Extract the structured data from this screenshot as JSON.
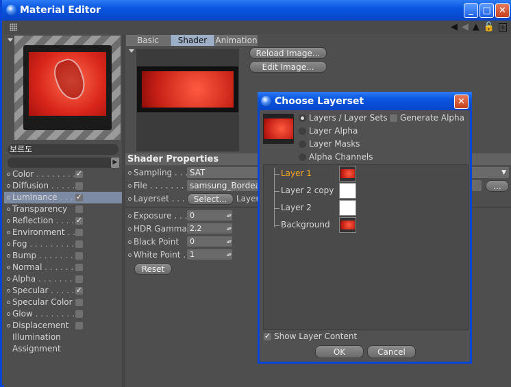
{
  "window": {
    "title": "Material Editor"
  },
  "material": {
    "name": "보르도"
  },
  "channels": [
    {
      "label": "Color",
      "dots": " . . . . . . . .",
      "checked": true
    },
    {
      "label": "Diffusion",
      "dots": " . . . . . .",
      "checked": false
    },
    {
      "label": "Luminance",
      "dots": " . . .",
      "checked": true,
      "selected": true
    },
    {
      "label": "Transparency",
      "dots": "",
      "checked": false
    },
    {
      "label": "Reflection",
      "dots": " . . . .",
      "checked": true
    },
    {
      "label": "Environment",
      "dots": " . .",
      "checked": false
    },
    {
      "label": "Fog",
      "dots": " . . . . . . . . . .",
      "checked": false
    },
    {
      "label": "Bump",
      "dots": " . . . . . . . .",
      "checked": false
    },
    {
      "label": "Normal",
      "dots": " . . . . . . .",
      "checked": false
    },
    {
      "label": "Alpha",
      "dots": " . . . . . . . .",
      "checked": false
    },
    {
      "label": "Specular",
      "dots": " . . . . .",
      "checked": true
    },
    {
      "label": "Specular Color",
      "dots": "",
      "checked": false
    },
    {
      "label": "Glow",
      "dots": " . . . . . . . . .",
      "checked": false
    },
    {
      "label": "Displacement",
      "dots": "",
      "checked": false
    }
  ],
  "extra_items": [
    "Illumination",
    "Assignment"
  ],
  "tabs": [
    "Basic",
    "Shader",
    "Animation"
  ],
  "active_tab": "Shader",
  "buttons": {
    "reload": "Reload Image...",
    "edit": "Edit Image...",
    "select": "Select...",
    "reset": "Reset",
    "more": "..."
  },
  "shader": {
    "section_title": "Shader Properties",
    "sampling_label": "Sampling . . .",
    "sampling_value": "SAT",
    "file_label": "File . . . . . . . .",
    "file_value": "samsung_Bordea",
    "layerset_label": "Layerset . . .",
    "layerset_value": "Layer"
  },
  "properties": [
    {
      "label": "Exposure . . . .",
      "value": "0"
    },
    {
      "label": "HDR Gamma",
      "value": "2.2"
    },
    {
      "label": "Black Point",
      "value": "0"
    },
    {
      "label": "White Point .",
      "value": "1"
    }
  ],
  "dialog": {
    "title": "Choose Layerset",
    "options": [
      "Layers / Layer Sets",
      "Layer Alpha",
      "Layer Masks",
      "Alpha Channels"
    ],
    "selected_option": "Layers / Layer Sets",
    "generate_alpha": "Generate Alpha",
    "layers": [
      {
        "name": "Layer 1",
        "selected": true,
        "thumb": "image"
      },
      {
        "name": "Layer 2 copy",
        "selected": false,
        "thumb": "white"
      },
      {
        "name": "Layer 2",
        "selected": false,
        "thumb": "white"
      },
      {
        "name": "Background",
        "selected": false,
        "thumb": "image"
      }
    ],
    "show_layer_content": "Show Layer Content",
    "ok": "OK",
    "cancel": "Cancel"
  },
  "colors": {
    "titlebar": "#0a55e0",
    "selected_channel": "#7d8aa3",
    "selected_layer": "#f5a623",
    "active_tab": "#9dafc7"
  }
}
